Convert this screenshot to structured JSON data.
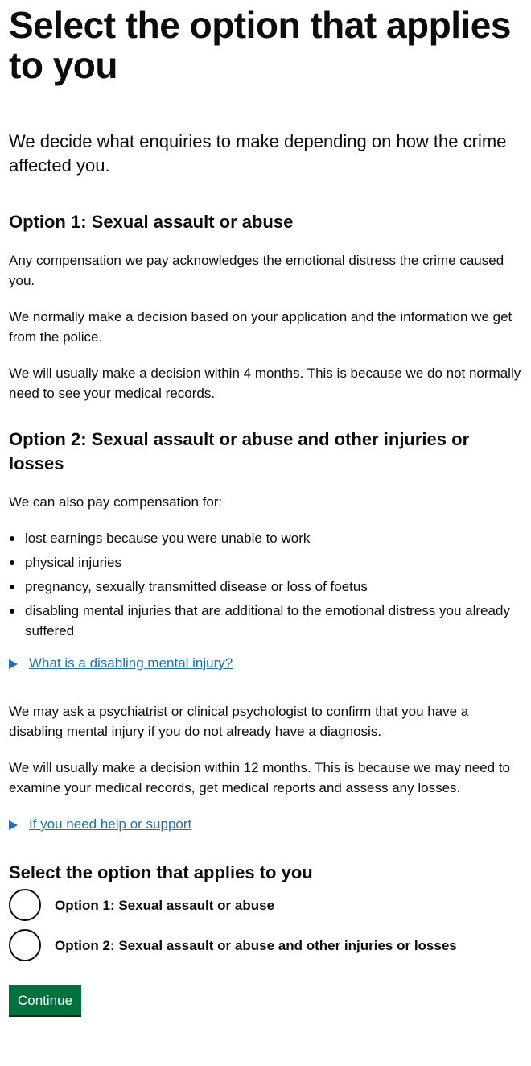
{
  "page": {
    "title": "Select the option that applies to you",
    "lead": "We decide what enquiries to make depending on how the crime affected you."
  },
  "option1": {
    "heading": "Option 1: Sexual assault or abuse",
    "paragraphs": [
      "Any compensation we pay acknowledges the emotional distress the crime caused you.",
      "We normally make a decision based on your application and the information we get from the police.",
      "We will usually make a decision within 4 months. This is because we do not normally need to see your medical records."
    ]
  },
  "option2": {
    "heading": "Option 2: Sexual assault or abuse and other injuries or losses",
    "intro": "We can also pay compensation for:",
    "bullets": [
      "lost earnings because you were unable to work",
      "physical injuries",
      "pregnancy, sexually transmitted disease or loss of foetus",
      "disabling mental injuries that are additional to the emotional distress you already suffered"
    ],
    "details_link": "What is a disabling mental injury?",
    "paragraphs": [
      "We may ask a psychiatrist or clinical psychologist to confirm that you have a disabling mental injury if you do not already have a diagnosis.",
      "We will usually make a decision within 12 months. This is because we may need to examine your medical records, get medical reports and assess any losses."
    ],
    "help_link": "If you need help or support"
  },
  "form": {
    "legend": "Select the option that applies to you",
    "options": [
      "Option 1: Sexual assault or abuse",
      "Option 2: Sexual assault or abuse and other injuries or losses"
    ],
    "continue_label": "Continue"
  },
  "colors": {
    "link": "#1d70b8",
    "button": "#00703c",
    "text": "#0b0c0c"
  },
  "icons": {
    "details_toggle": "triangle-right-icon"
  }
}
